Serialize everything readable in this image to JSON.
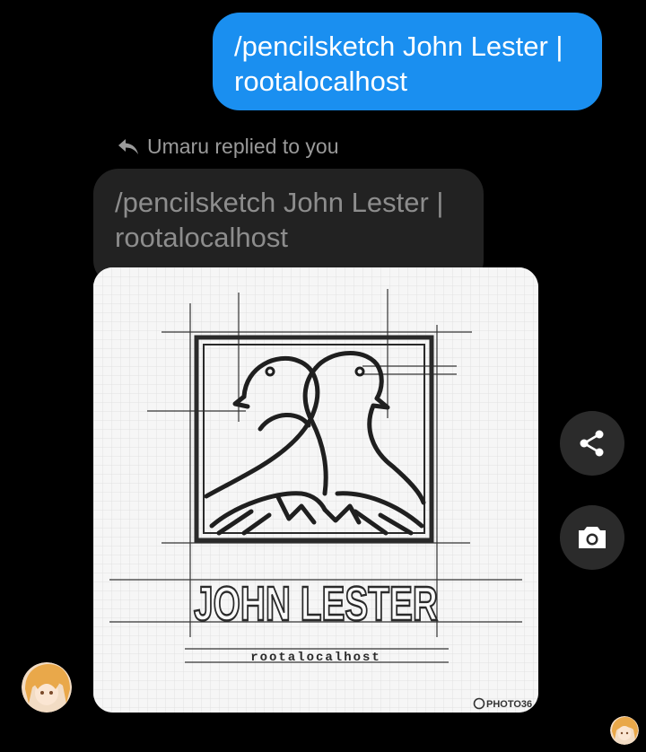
{
  "sent_message": {
    "text": "/pencilsketch John Lester | rootalocalhost",
    "color": "#1a8ff0"
  },
  "reply": {
    "header": "Umaru replied to you",
    "quoted_text": "/pencilsketch John Lester | rootalocalhost"
  },
  "image": {
    "name_text": "JOHN LESTER",
    "tagline": "rootalocalhost",
    "watermark": "PHOTO36"
  },
  "actions": {
    "share_icon": "share-icon",
    "camera_icon": "camera-icon"
  }
}
